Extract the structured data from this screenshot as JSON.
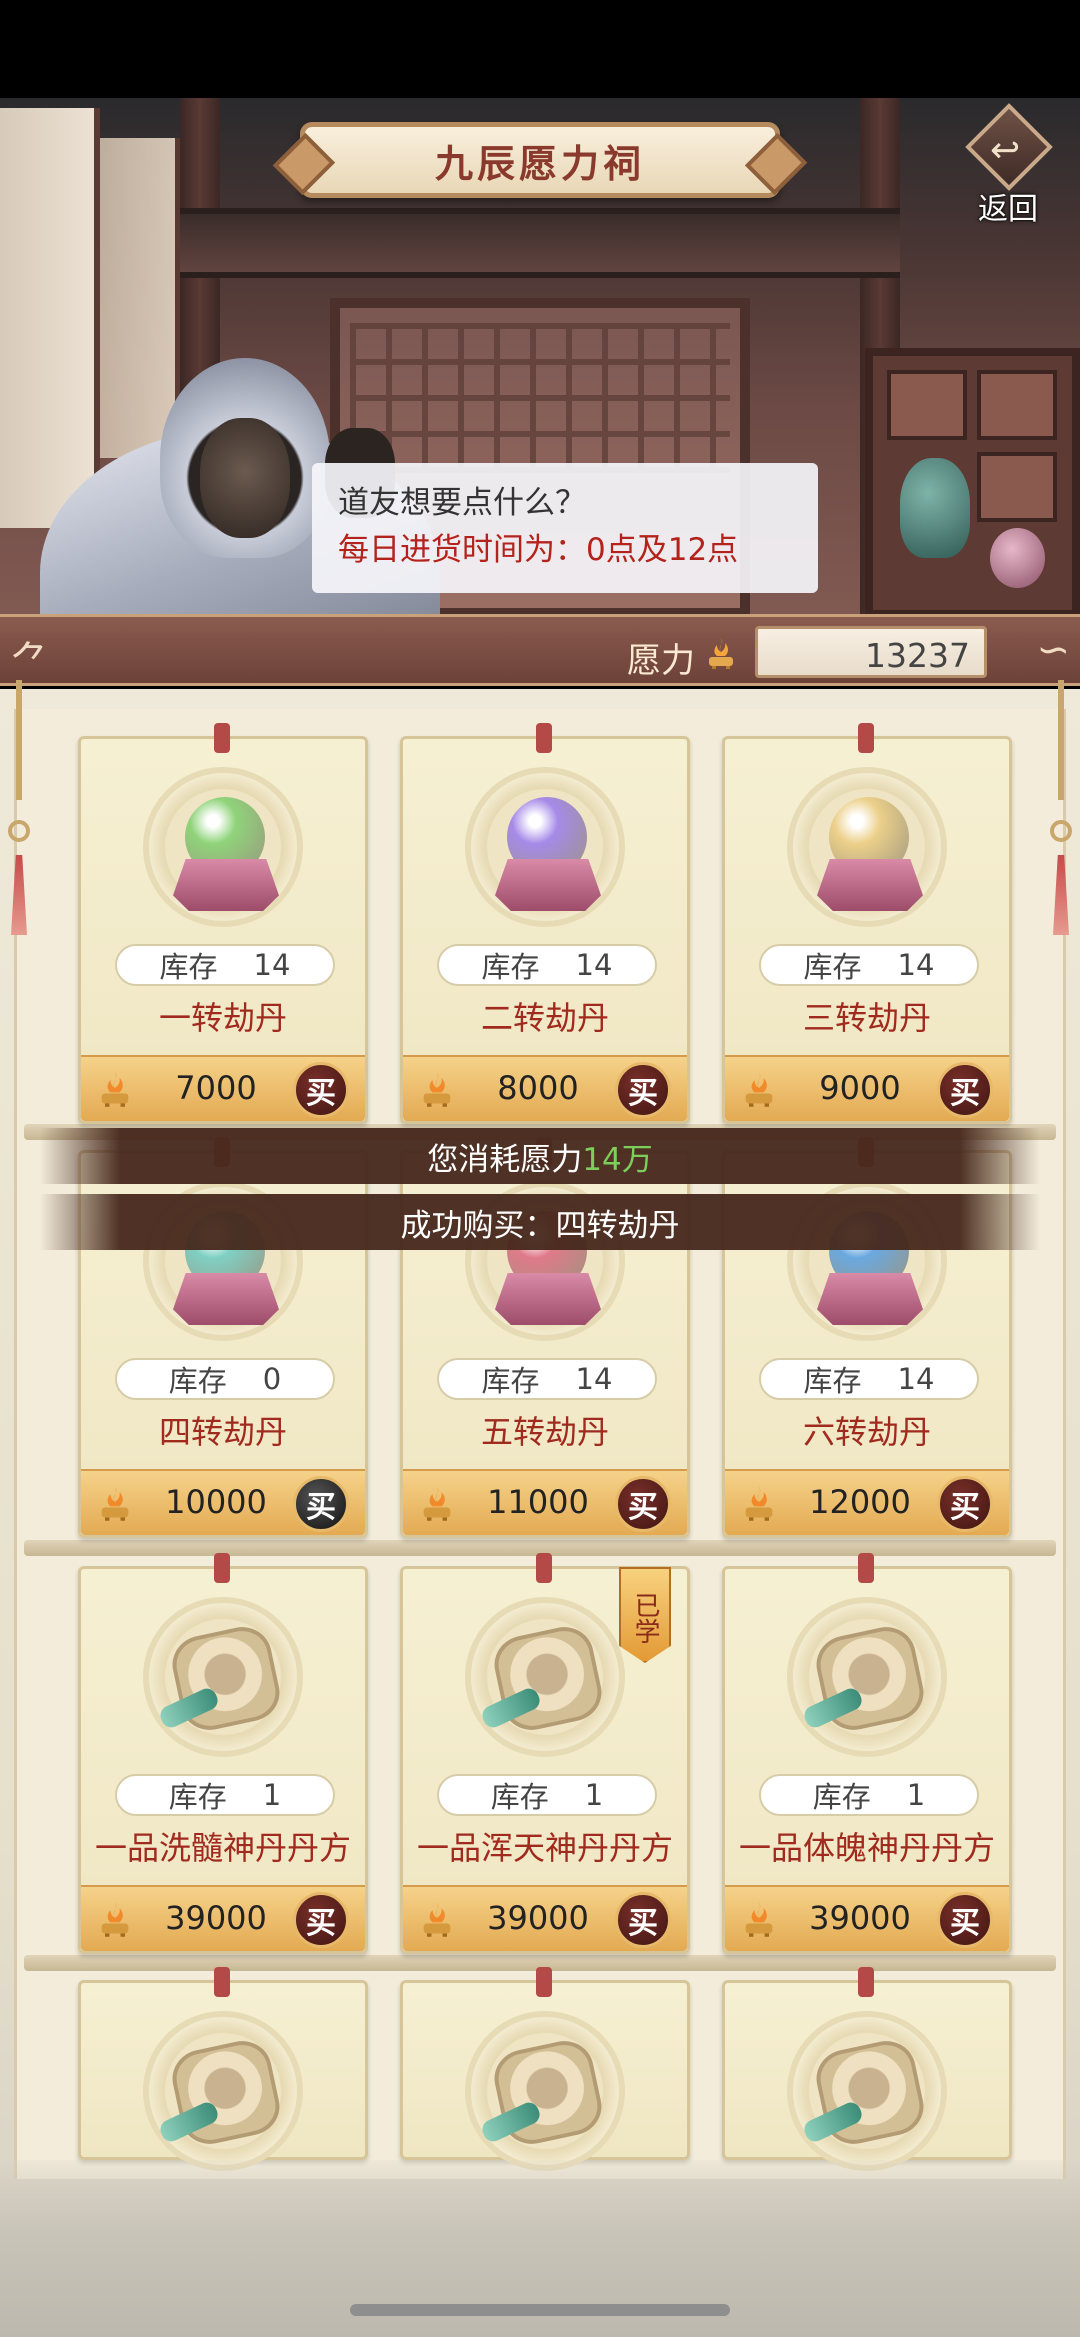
{
  "header": {
    "title": "九辰愿力祠",
    "back_label": "返回"
  },
  "dialog": {
    "line1": "道友想要点什么？",
    "line2": "每日进货时间为：0点及12点"
  },
  "resource": {
    "label": "愿力",
    "icon": "incense-burner-icon",
    "value": "13237"
  },
  "toasts": {
    "consume_prefix": "您消耗愿力",
    "consume_amount": "14万",
    "purchase": "成功购买：四转劫丹"
  },
  "stock_label": "库存",
  "buy_label": "买",
  "learned_label": "已学",
  "items": [
    {
      "name": "一转劫丹",
      "stock": "14",
      "price": "7000",
      "type": "orb",
      "color": "#8fd37a"
    },
    {
      "name": "二转劫丹",
      "stock": "14",
      "price": "8000",
      "type": "orb",
      "color": "#a68ae8"
    },
    {
      "name": "三转劫丹",
      "stock": "14",
      "price": "9000",
      "type": "orb",
      "color": "#ecd08a"
    },
    {
      "name": "四转劫丹",
      "stock": "0",
      "price": "10000",
      "type": "orb",
      "color": "#7fd0c4"
    },
    {
      "name": "五转劫丹",
      "stock": "14",
      "price": "11000",
      "type": "orb",
      "color": "#e07a8a"
    },
    {
      "name": "六转劫丹",
      "stock": "14",
      "price": "12000",
      "type": "orb",
      "color": "#6aa9e0"
    },
    {
      "name": "一品洗髓神丹丹方",
      "stock": "1",
      "price": "39000",
      "type": "scroll"
    },
    {
      "name": "一品浑天神丹丹方",
      "stock": "1",
      "price": "39000",
      "type": "scroll"
    },
    {
      "name": "一品体魄神丹丹方",
      "stock": "1",
      "price": "39000",
      "type": "scroll"
    }
  ],
  "colors": {
    "accent_red": "#a12a1e",
    "price_bar": "#e3aa52",
    "highlight_green": "#7ccf5a"
  }
}
